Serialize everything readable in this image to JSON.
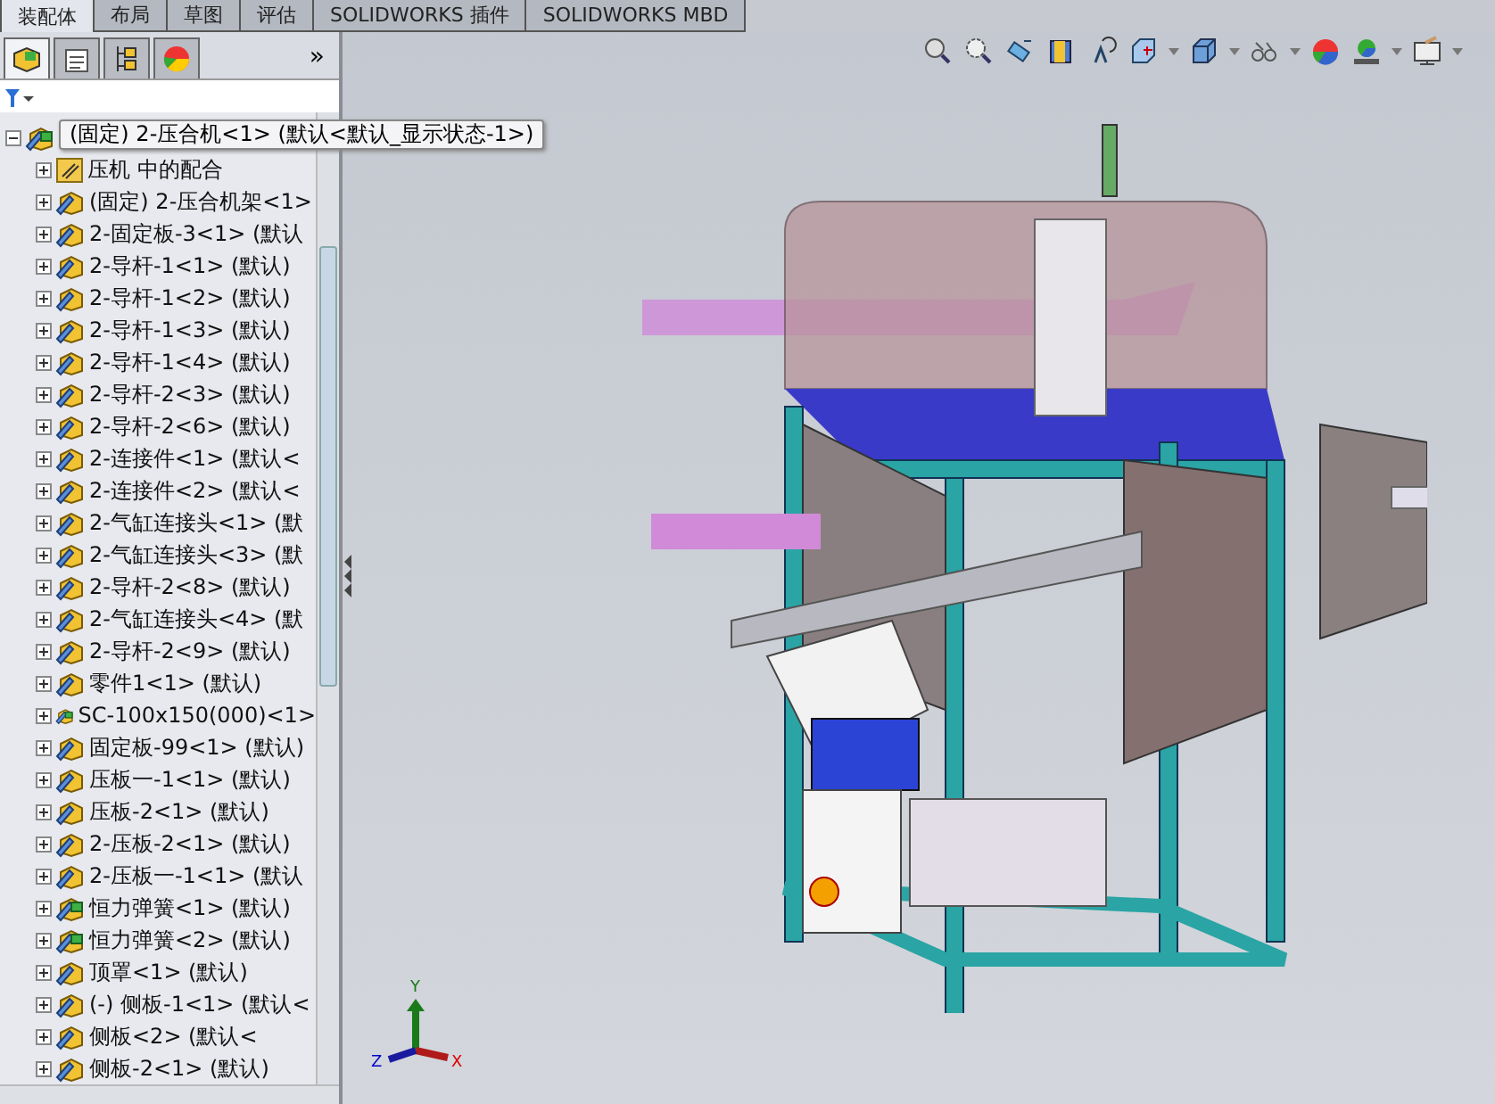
{
  "tabs": [
    {
      "label": "装配体",
      "selected": true
    },
    {
      "label": "布局",
      "selected": false
    },
    {
      "label": "草图",
      "selected": false
    },
    {
      "label": "评估",
      "selected": false
    },
    {
      "label": "SOLIDWORKS 插件",
      "selected": false
    },
    {
      "label": "SOLIDWORKS MBD",
      "selected": false
    }
  ],
  "panel_tabs": [
    {
      "kind": "tree",
      "selected": true
    },
    {
      "kind": "properties",
      "selected": false
    },
    {
      "kind": "config",
      "selected": false
    },
    {
      "kind": "display",
      "selected": false
    }
  ],
  "panel_more": "»",
  "tree": {
    "kind": "assembly",
    "expanded": true,
    "tooltip": "(固定) 2-压合机<1> (默认<默认_显示状态-1>)",
    "children": [
      {
        "kind": "mates",
        "expanded": false,
        "label": "压机 中的配合"
      },
      {
        "kind": "component",
        "expanded": false,
        "label": "(固定) 2-压合机架<1>"
      },
      {
        "kind": "component",
        "expanded": false,
        "label": "2-固定板-3<1> (默认"
      },
      {
        "kind": "component",
        "expanded": false,
        "label": "2-导杆-1<1> (默认)"
      },
      {
        "kind": "component",
        "expanded": false,
        "label": "2-导杆-1<2> (默认)"
      },
      {
        "kind": "component",
        "expanded": false,
        "label": "2-导杆-1<3> (默认)"
      },
      {
        "kind": "component",
        "expanded": false,
        "label": "2-导杆-1<4> (默认)"
      },
      {
        "kind": "component",
        "expanded": false,
        "label": "2-导杆-2<3> (默认)"
      },
      {
        "kind": "component",
        "expanded": false,
        "label": "2-导杆-2<6> (默认)"
      },
      {
        "kind": "component",
        "expanded": false,
        "label": "2-连接件<1> (默认<"
      },
      {
        "kind": "component",
        "expanded": false,
        "label": "2-连接件<2> (默认<"
      },
      {
        "kind": "component",
        "expanded": false,
        "label": "2-气缸连接头<1> (默"
      },
      {
        "kind": "component",
        "expanded": false,
        "label": "2-气缸连接头<3> (默"
      },
      {
        "kind": "component",
        "expanded": false,
        "label": "2-导杆-2<8> (默认)"
      },
      {
        "kind": "component",
        "expanded": false,
        "label": "2-气缸连接头<4> (默"
      },
      {
        "kind": "component",
        "expanded": false,
        "label": "2-导杆-2<9> (默认)"
      },
      {
        "kind": "component",
        "expanded": false,
        "label": "零件1<1> (默认)"
      },
      {
        "kind": "subassembly",
        "expanded": false,
        "label": "SC-100x150(000)<1>"
      },
      {
        "kind": "component",
        "expanded": false,
        "label": "固定板-99<1> (默认)"
      },
      {
        "kind": "component",
        "expanded": false,
        "label": "压板一-1<1> (默认)"
      },
      {
        "kind": "component",
        "expanded": false,
        "label": "压板-2<1> (默认)"
      },
      {
        "kind": "component",
        "expanded": false,
        "label": "2-压板-2<1> (默认)"
      },
      {
        "kind": "component",
        "expanded": false,
        "label": "2-压板一-1<1> (默认"
      },
      {
        "kind": "subassembly",
        "expanded": false,
        "label": "恒力弹簧<1> (默认)"
      },
      {
        "kind": "subassembly",
        "expanded": false,
        "label": "恒力弹簧<2> (默认)"
      },
      {
        "kind": "component",
        "expanded": false,
        "label": "顶罩<1> (默认)"
      },
      {
        "kind": "component",
        "expanded": false,
        "label": "(-) 侧板-1<1> (默认<"
      },
      {
        "kind": "component",
        "expanded": false,
        "label": "侧板<2> (默认<"
      },
      {
        "kind": "component",
        "expanded": false,
        "label": "侧板-2<1> (默认)"
      }
    ]
  },
  "view_toolbar": [
    {
      "kind": "zoom-fit",
      "menu": false
    },
    {
      "kind": "zoom-area",
      "menu": false
    },
    {
      "kind": "previous-view",
      "menu": false
    },
    {
      "kind": "section",
      "menu": false
    },
    {
      "kind": "dynamic",
      "menu": false
    },
    {
      "kind": "orientation",
      "menu": true
    },
    {
      "kind": "display-style",
      "menu": true
    },
    {
      "kind": "hide-show",
      "menu": true
    },
    {
      "kind": "appearance",
      "menu": false
    },
    {
      "kind": "scene",
      "menu": true
    },
    {
      "kind": "settings",
      "menu": true
    }
  ],
  "triad": {
    "x": "X",
    "y": "Y",
    "z": "Z"
  }
}
